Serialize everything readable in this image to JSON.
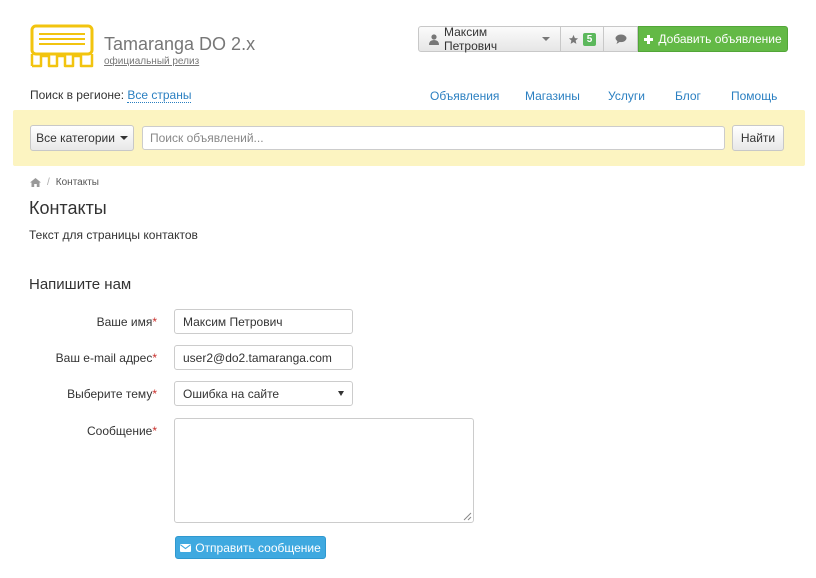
{
  "header": {
    "brand_title": "Tamaranga DO 2.x",
    "brand_subtitle": "официальный релиз",
    "user_name": "Максим Петрович",
    "favorites_count": "5",
    "add_listing_label": "Добавить объявление"
  },
  "region": {
    "label": "Поиск в регионе:",
    "value": "Все страны"
  },
  "nav": {
    "items": [
      "Объявления",
      "Магазины",
      "Услуги",
      "Блог",
      "Помощь"
    ]
  },
  "search": {
    "category_label": "Все категории",
    "placeholder": "Поиск объявлений...",
    "find_label": "Найти"
  },
  "breadcrumb": {
    "current": "Контакты"
  },
  "page": {
    "title": "Контакты",
    "text": "Текст для страницы контактов"
  },
  "form": {
    "title": "Напишите нам",
    "name_label": "Ваше имя",
    "name_value": "Максим Петрович",
    "email_label": "Ваш e-mail адрес",
    "email_value": "user2@do2.tamaranga.com",
    "topic_label": "Выберите тему",
    "topic_value": "Ошибка на сайте",
    "message_label": "Сообщение",
    "required_mark": "*",
    "submit_label": "Отправить сообщение"
  },
  "colors": {
    "accent_green": "#63b946",
    "link_blue": "#2a7fc1",
    "search_bg": "#fcf4c1",
    "submit_blue": "#3fa9e0",
    "logo_yellow": "#f2c40f"
  },
  "icons": {
    "user": "user-icon",
    "star": "star-icon",
    "chat": "comment-icon",
    "plus": "plus-icon",
    "home": "home-icon",
    "envelope": "envelope-icon"
  }
}
